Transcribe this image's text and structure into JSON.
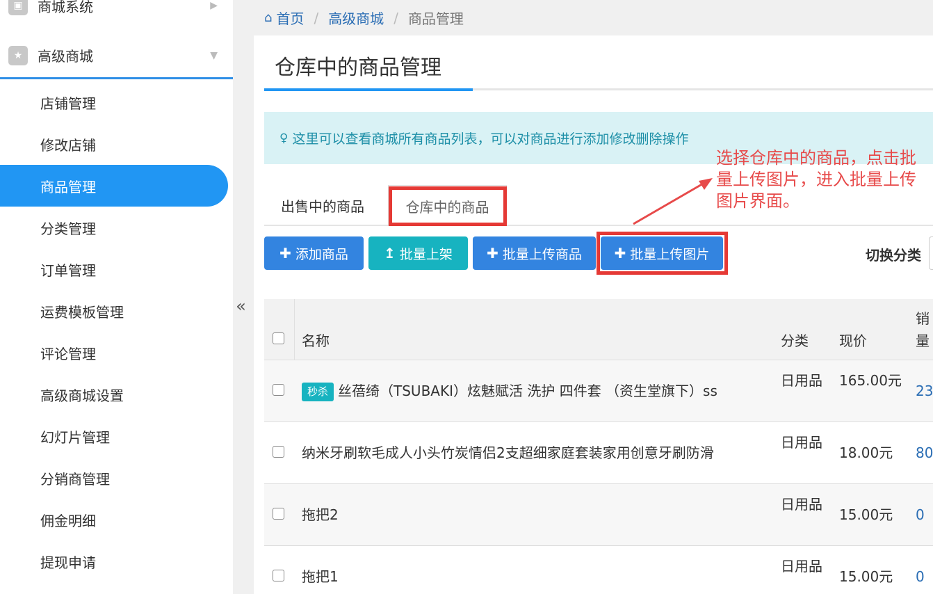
{
  "sidebar": {
    "top_group": "商城系统",
    "group": "高级商城",
    "items": [
      {
        "label": "店铺管理",
        "active": false
      },
      {
        "label": "修改店铺",
        "active": false
      },
      {
        "label": "商品管理",
        "active": true
      },
      {
        "label": "分类管理",
        "active": false
      },
      {
        "label": "订单管理",
        "active": false
      },
      {
        "label": "运费模板管理",
        "active": false
      },
      {
        "label": "评论管理",
        "active": false
      },
      {
        "label": "高级商城设置",
        "active": false
      },
      {
        "label": "幻灯片管理",
        "active": false
      },
      {
        "label": "分销商管理",
        "active": false
      },
      {
        "label": "佣金明细",
        "active": false
      },
      {
        "label": "提现申请",
        "active": false
      }
    ],
    "collapse_glyph": "«"
  },
  "breadcrumb": {
    "home": "首页",
    "level1": "高级商城",
    "current": "商品管理",
    "separator": "/"
  },
  "page": {
    "title": "仓库中的商品管理",
    "tip": "这里可以查看商城所有商品列表，可以对商品进行添加修改删除操作"
  },
  "annotation": {
    "text": "选择仓库中的商品，点击批量上传图片，进入批量上传图片界面。",
    "color": "#e74a4a"
  },
  "tabs": [
    {
      "label": "出售中的商品",
      "active": false
    },
    {
      "label": "仓库中的商品",
      "active": true
    }
  ],
  "toolbar": {
    "add": "添加商品",
    "batch_shelf": "批量上架",
    "batch_upload_goods": "批量上传商品",
    "batch_upload_images": "批量上传图片",
    "switch_category": "切换分类"
  },
  "table": {
    "headers": {
      "name": "名称",
      "category": "分类",
      "price": "现价",
      "sales": "销量"
    },
    "rows": [
      {
        "badge": "秒杀",
        "name": "丝蓓绮（TSUBAKI）炫魅赋活 洗护 四件套 （资生堂旗下）ss",
        "category": "日用品",
        "price": "165.00元",
        "sales": "23"
      },
      {
        "badge": "",
        "name": "纳米牙刷软毛成人小头竹炭情侣2支超细家庭套装家用创意牙刷防滑",
        "category": "日用品",
        "price": "18.00元",
        "sales": "80"
      },
      {
        "badge": "",
        "name": "拖把2",
        "category": "日用品",
        "price": "15.00元",
        "sales": "0"
      },
      {
        "badge": "",
        "name": "拖把1",
        "category": "日用品",
        "price": "15.00元",
        "sales": "0"
      }
    ]
  },
  "colors": {
    "primary": "#2196f3",
    "button_blue": "#3384e0",
    "button_teal": "#17b3c0",
    "highlight_red": "#e53935",
    "link": "#2a6db4"
  }
}
